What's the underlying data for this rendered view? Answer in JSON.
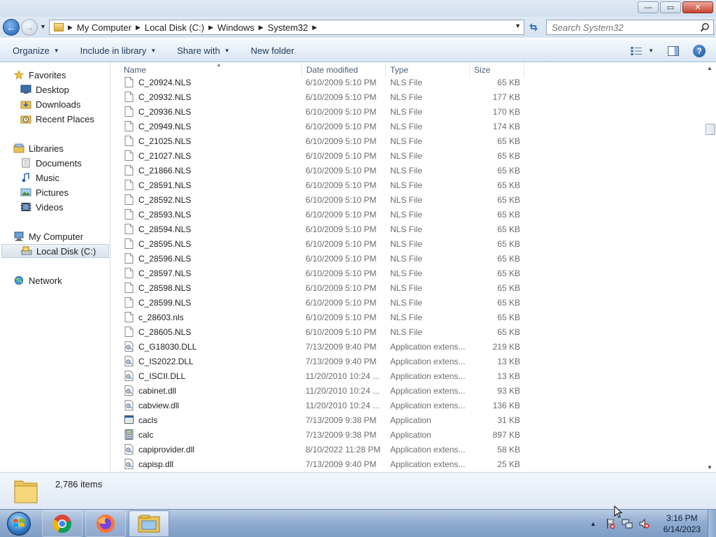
{
  "window": {
    "controls": {
      "minimize": "—",
      "maximize": "▭",
      "close": "✕"
    }
  },
  "addressbar": {
    "crumbs": [
      "My Computer",
      "Local Disk (C:)",
      "Windows",
      "System32"
    ],
    "search_placeholder": "Search System32"
  },
  "toolbar": {
    "organize": "Organize",
    "include_in_library": "Include in library",
    "share_with": "Share with",
    "new_folder": "New folder"
  },
  "navpane": {
    "favorites": {
      "label": "Favorites",
      "items": [
        "Desktop",
        "Downloads",
        "Recent Places"
      ]
    },
    "libraries": {
      "label": "Libraries",
      "items": [
        "Documents",
        "Music",
        "Pictures",
        "Videos"
      ]
    },
    "computer": {
      "label": "My Computer",
      "items": [
        "Local Disk (C:)"
      ],
      "selected": "Local Disk (C:)"
    },
    "network": {
      "label": "Network"
    }
  },
  "columns": {
    "name": "Name",
    "date": "Date modified",
    "type": "Type",
    "size": "Size"
  },
  "files": [
    {
      "name": "C_20924.NLS",
      "date": "6/10/2009 5:10 PM",
      "type": "NLS File",
      "size": "65 KB",
      "icon": "file-icon"
    },
    {
      "name": "C_20932.NLS",
      "date": "6/10/2009 5:10 PM",
      "type": "NLS File",
      "size": "177 KB",
      "icon": "file-icon"
    },
    {
      "name": "C_20936.NLS",
      "date": "6/10/2009 5:10 PM",
      "type": "NLS File",
      "size": "170 KB",
      "icon": "file-icon"
    },
    {
      "name": "C_20949.NLS",
      "date": "6/10/2009 5:10 PM",
      "type": "NLS File",
      "size": "174 KB",
      "icon": "file-icon"
    },
    {
      "name": "C_21025.NLS",
      "date": "6/10/2009 5:10 PM",
      "type": "NLS File",
      "size": "65 KB",
      "icon": "file-icon"
    },
    {
      "name": "C_21027.NLS",
      "date": "6/10/2009 5:10 PM",
      "type": "NLS File",
      "size": "65 KB",
      "icon": "file-icon"
    },
    {
      "name": "C_21866.NLS",
      "date": "6/10/2009 5:10 PM",
      "type": "NLS File",
      "size": "65 KB",
      "icon": "file-icon"
    },
    {
      "name": "C_28591.NLS",
      "date": "6/10/2009 5:10 PM",
      "type": "NLS File",
      "size": "65 KB",
      "icon": "file-icon"
    },
    {
      "name": "C_28592.NLS",
      "date": "6/10/2009 5:10 PM",
      "type": "NLS File",
      "size": "65 KB",
      "icon": "file-icon"
    },
    {
      "name": "C_28593.NLS",
      "date": "6/10/2009 5:10 PM",
      "type": "NLS File",
      "size": "65 KB",
      "icon": "file-icon"
    },
    {
      "name": "C_28594.NLS",
      "date": "6/10/2009 5:10 PM",
      "type": "NLS File",
      "size": "65 KB",
      "icon": "file-icon"
    },
    {
      "name": "C_28595.NLS",
      "date": "6/10/2009 5:10 PM",
      "type": "NLS File",
      "size": "65 KB",
      "icon": "file-icon"
    },
    {
      "name": "C_28596.NLS",
      "date": "6/10/2009 5:10 PM",
      "type": "NLS File",
      "size": "65 KB",
      "icon": "file-icon"
    },
    {
      "name": "C_28597.NLS",
      "date": "6/10/2009 5:10 PM",
      "type": "NLS File",
      "size": "65 KB",
      "icon": "file-icon"
    },
    {
      "name": "C_28598.NLS",
      "date": "6/10/2009 5:10 PM",
      "type": "NLS File",
      "size": "65 KB",
      "icon": "file-icon"
    },
    {
      "name": "C_28599.NLS",
      "date": "6/10/2009 5:10 PM",
      "type": "NLS File",
      "size": "65 KB",
      "icon": "file-icon"
    },
    {
      "name": "c_28603.nls",
      "date": "6/10/2009 5:10 PM",
      "type": "NLS File",
      "size": "65 KB",
      "icon": "file-icon"
    },
    {
      "name": "C_28605.NLS",
      "date": "6/10/2009 5:10 PM",
      "type": "NLS File",
      "size": "65 KB",
      "icon": "file-icon"
    },
    {
      "name": "C_G18030.DLL",
      "date": "7/13/2009 9:40 PM",
      "type": "Application extens...",
      "size": "219 KB",
      "icon": "dll-icon"
    },
    {
      "name": "C_IS2022.DLL",
      "date": "7/13/2009 9:40 PM",
      "type": "Application extens...",
      "size": "13 KB",
      "icon": "dll-icon"
    },
    {
      "name": "C_ISCII.DLL",
      "date": "11/20/2010 10:24 ...",
      "type": "Application extens...",
      "size": "13 KB",
      "icon": "dll-icon"
    },
    {
      "name": "cabinet.dll",
      "date": "11/20/2010 10:24 ...",
      "type": "Application extens...",
      "size": "93 KB",
      "icon": "dll-icon"
    },
    {
      "name": "cabview.dll",
      "date": "11/20/2010 10:24 ...",
      "type": "Application extens...",
      "size": "136 KB",
      "icon": "dll-icon"
    },
    {
      "name": "cacls",
      "date": "7/13/2009 9:38 PM",
      "type": "Application",
      "size": "31 KB",
      "icon": "application-icon"
    },
    {
      "name": "calc",
      "date": "7/13/2009 9:38 PM",
      "type": "Application",
      "size": "897 KB",
      "icon": "calculator-icon"
    },
    {
      "name": "capiprovider.dll",
      "date": "8/10/2022 11:28 PM",
      "type": "Application extens...",
      "size": "58 KB",
      "icon": "dll-icon"
    },
    {
      "name": "capisp.dll",
      "date": "7/13/2009 9:40 PM",
      "type": "Application extens...",
      "size": "25 KB",
      "icon": "dll-icon"
    }
  ],
  "details": {
    "item_count": "2,786 items"
  },
  "taskbar": {
    "apps": [
      "chrome-icon",
      "firefox-icon",
      "explorer-icon"
    ],
    "active_app": "explorer-icon",
    "clock_time": "3:16 PM",
    "clock_date": "6/14/2023"
  },
  "colors": {
    "toolbar_text": "#1e395b",
    "secondary_text": "#6d6d6d",
    "header_text": "#4c607a",
    "close_button": "#c8432f"
  }
}
